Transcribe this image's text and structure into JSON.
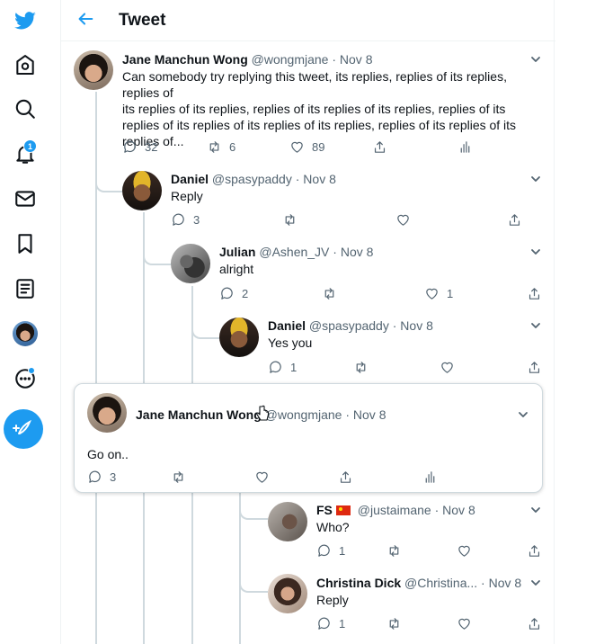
{
  "colors": {
    "accent": "#1d9bf0",
    "text": "#0f1419",
    "muted": "#536471",
    "line": "#cfd9de"
  },
  "nav": {
    "items": [
      "twitter-logo-icon",
      "home-icon",
      "search-icon",
      "notifications-icon",
      "messages-icon",
      "bookmarks-icon",
      "lists-icon",
      "profile-avatar",
      "more-icon"
    ],
    "notification_count": "1",
    "compose_icon": "compose-tweet-icon"
  },
  "header": {
    "title": "Tweet",
    "back_icon": "arrow-left-icon"
  },
  "tweets": [
    {
      "name": "Jane Manchun Wong",
      "handle": "@wongmjane",
      "date": "Nov 8",
      "separator": "·",
      "text_lines": [
        "Can somebody try replying this tweet, its replies, replies of its replies, replies of",
        "its replies of its replies, replies of its replies of its replies, replies of its",
        "replies of its replies of its replies of its replies, replies of its replies of its",
        "replies of..."
      ],
      "replies": "32",
      "retweets": "6",
      "likes": "89"
    },
    {
      "name": "Daniel",
      "handle": "@spasypaddy",
      "date": "Nov 8",
      "separator": "·",
      "text": "Reply",
      "replies": "3",
      "retweets": "",
      "likes": ""
    },
    {
      "name": "Julian",
      "handle": "@Ashen_JV",
      "date": "Nov 8",
      "separator": "·",
      "text": "alright",
      "replies": "2",
      "retweets": "",
      "likes": "1"
    },
    {
      "name": "Daniel",
      "handle": "@spasypaddy",
      "date": "Nov 8",
      "separator": "·",
      "text": "Yes you",
      "replies": "1",
      "retweets": "",
      "likes": ""
    },
    {
      "name": "Jane Manchun Wong",
      "handle": "@wongmjane",
      "date": "Nov 8",
      "separator": "·",
      "text": "Go on..",
      "replies": "3",
      "retweets": "",
      "likes": ""
    },
    {
      "name": "FS",
      "handle": "@justaimane",
      "date": "Nov 8",
      "separator": "·",
      "text": "Who?",
      "replies": "1",
      "retweets": "",
      "likes": ""
    },
    {
      "name": "Christina Dick",
      "handle": "@Christina...",
      "date": "Nov 8",
      "separator": "·",
      "text": "Reply",
      "replies": "1",
      "retweets": "",
      "likes": ""
    }
  ]
}
